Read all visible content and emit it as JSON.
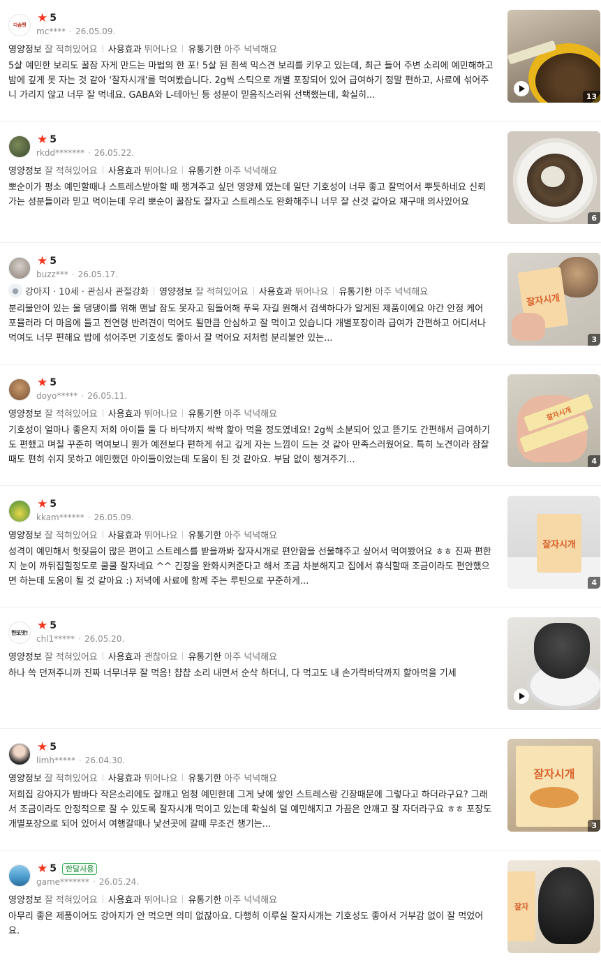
{
  "colors": {
    "star": "#f4361e",
    "tag_label": "#222222",
    "tag_value": "#6e6e6e",
    "meta": "#8a8a8a",
    "badge": "#1f8a3b"
  },
  "reviews": [
    {
      "star_icon": "★",
      "rating": "5",
      "avatar_text": "다솜펫",
      "user": "mc****",
      "date": "26.05.09.",
      "tags": [
        {
          "label": "영양정보",
          "value": "잘 적혀있어요"
        },
        {
          "label": "사용효과",
          "value": "뛰어나요"
        },
        {
          "label": "유통기한",
          "value": "아주 넉넉해요"
        }
      ],
      "text": "5살 예민한 보리도 꿀잠 자게 만드는 마법의 한 포! 5살 된 흰색 믹스견 보리를 키우고 있는데, 최근 들어 주변 소리에 예민해하고 밤에 깊게 못 자는 것 같아 '잘자시개'를 먹여봤습니다. 2g씩 스틱으로 개별 포장되어 있어 급여하기 정말 편하고, 사료에 섞어주니 가리지 않고 너무 잘 먹네요. GABA와 L-테아닌 등 성분이 믿음직스러워 선택했는데, 확실히...",
      "media_count": "13",
      "video": true
    },
    {
      "star_icon": "★",
      "rating": "5",
      "user": "rkdd*******",
      "date": "26.05.22.",
      "tags": [
        {
          "label": "영양정보",
          "value": "잘 적혀있어요"
        },
        {
          "label": "사용효과",
          "value": "뛰어나요"
        },
        {
          "label": "유통기한",
          "value": "아주 넉넉해요"
        }
      ],
      "text": "뽀순이가 평소 예민할때나 스트레스받아할 때 챙겨주고 싶던 영양제 였는데 일단 기호성이 너무 좋고 잘먹어서 뿌듯하네요 신뢰가는 성분들이라 믿고 먹이는데 우리 뽀순이 꿀잠도 잘자고 스트레스도 완화해주니 너무 잘 산것 같아요 재구매 의사있어요",
      "media_count": "6",
      "video": false
    },
    {
      "star_icon": "★",
      "rating": "5",
      "user": "buzz***",
      "date": "26.05.17.",
      "pet_info": "강아지 · 10세 · 관심사 관절강화",
      "tags": [
        {
          "label": "영양정보",
          "value": "잘 적혀있어요"
        },
        {
          "label": "사용효과",
          "value": "뛰어나요"
        },
        {
          "label": "유통기한",
          "value": "아주 넉넉해요"
        }
      ],
      "text": "분리불안이 있는 울 댕댕이를 위해 맨날 잠도 못자고 힘들어해 푸욱 자길 원해서 검색하다가 알게된 제품이에요 야간 안정 케어 포뮬러라 더 마음에 들고 전연령 반려견이 먹어도 될만큼 안심하고 잘 먹이고 있습니다 개별포장이라 급여가 간편하고 어디서나 먹여도 너무 편해요 밥에 섞어주면 기호성도 좋아서 잘 먹어요 저처럼 분리불안 있는...",
      "media_count": "3",
      "video": false,
      "product_text": "잘자시개"
    },
    {
      "star_icon": "★",
      "rating": "5",
      "user": "doyo*****",
      "date": "26.05.11.",
      "tags": [
        {
          "label": "영양정보",
          "value": "잘 적혀있어요"
        },
        {
          "label": "사용효과",
          "value": "뛰어나요"
        },
        {
          "label": "유통기한",
          "value": "아주 넉넉해요"
        }
      ],
      "text": "기호성이 얼마나 좋은지 저희 아이들 둘 다 바닥까지 싹싹 핥아 먹을 정도였네요! 2g씩 소분되어 있고 뜯기도 간편해서 급여하기도 편했고 며칠 꾸준히 먹여보니 뭔가 예전보다 편하게 쉬고 깊게 자는 느낌이 드는 것 같아 만족스러웠어요. 특히 노견이라 잠잘때도 편히 쉬지 못하고 예민했던 아이들이었는데 도움이 된 것 같아요. 부담 없이 챙겨주기...",
      "media_count": "4",
      "video": false,
      "product_text": "잘자시개"
    },
    {
      "star_icon": "★",
      "rating": "5",
      "user": "kkam******",
      "date": "26.05.09.",
      "tags": [
        {
          "label": "영양정보",
          "value": "잘 적혀있어요"
        },
        {
          "label": "사용효과",
          "value": "뛰어나요"
        },
        {
          "label": "유통기한",
          "value": "아주 넉넉해요"
        }
      ],
      "text": "성격이 예민해서 헛짖음이 많은 편이고 스트레스를 받을까봐 잘자시개로 편안함을 선물해주고 싶어서 먹여봤어요 ㅎㅎ 진짜 편한지 눈이 까뒤집힐정도로 쿨쿨 잘자네요 ^^ 긴장을 완화시켜준다고 해서 조금 차분해지고 집에서 휴식할때 조금이라도 편안했으면 하는데 도움이 될 것 같아요 :) 저녁에 사료에 함께 주는 루틴으로 꾸준하게...",
      "media_count": "4",
      "video": false,
      "product_text": "잘자시개"
    },
    {
      "star_icon": "★",
      "rating": "5",
      "avatar_text": "한또맛!",
      "user": "chl1*****",
      "date": "26.05.20.",
      "tags": [
        {
          "label": "영양정보",
          "value": "잘 적혀있어요"
        },
        {
          "label": "사용효과",
          "value": "괜찮아요"
        },
        {
          "label": "유통기한",
          "value": "아주 넉넉해요"
        }
      ],
      "text": "하나 쓱 던져주니까 진짜 너무너무 잘 먹음! 챱챱 소리 내면서 순삭 하더니, 다 먹고도 내 손가락바닥까지 핥아먹을 기세",
      "media_count": "",
      "video": true
    },
    {
      "star_icon": "★",
      "rating": "5",
      "user": "limh*****",
      "date": "26.04.30.",
      "tags": [
        {
          "label": "영양정보",
          "value": "잘 적혀있어요"
        },
        {
          "label": "사용효과",
          "value": "뛰어나요"
        },
        {
          "label": "유통기한",
          "value": "아주 넉넉해요"
        }
      ],
      "text": "저희집 강아지가 밤바다 작은소리에도 잘깨고 엄청 예민한데 그게 낮에 쌓인 스트레스랑 긴장때문에 그렇다고 하더라구요? 그래서 조금이라도 안정적으로 잘 수 있도록 잘자시개 먹이고 있는데 확실히 덜 예민해지고 가끔은 안깨고 잘 자더라구요 ㅎㅎ 포장도 개별포장으로 되어 있어서 여행갈때나 낯선곳에 갈때 무조건 챙기는...",
      "media_count": "3",
      "video": false,
      "product_text": "잘자시개"
    },
    {
      "star_icon": "★",
      "rating": "5",
      "badge": "한달사용",
      "user": "game*******",
      "date": "26.05.24.",
      "tags": [
        {
          "label": "영양정보",
          "value": "잘 적혀있어요"
        },
        {
          "label": "사용효과",
          "value": "뛰어나요"
        },
        {
          "label": "유통기한",
          "value": "아주 넉넉해요"
        }
      ],
      "text": "아무리 좋은 제품이어도 강아지가 안 먹으면 의미 없잖아요. 다행히 이루실 잘자시개는 기호성도 좋아서 거부감 없이 잘 먹었어요.",
      "media_count": "",
      "video": false,
      "product_text": "잘자"
    }
  ]
}
